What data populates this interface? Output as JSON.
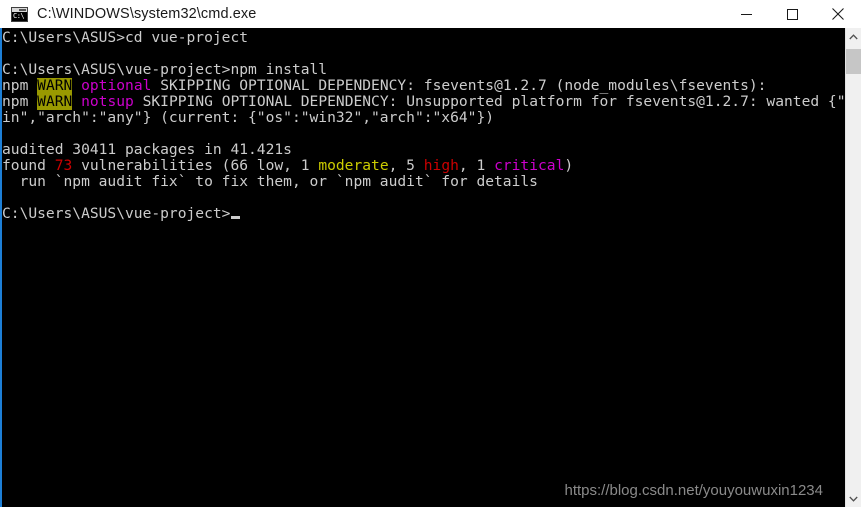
{
  "window": {
    "title": "C:\\WINDOWS\\system32\\cmd.exe",
    "icon_name": "cmd-icon",
    "icon_glyph": "C:\\",
    "controls": {
      "minimize_label": "Minimize",
      "maximize_label": "Maximize",
      "close_label": "Close"
    }
  },
  "console": {
    "background_color": "#000000",
    "foreground_color": "#cccccc",
    "focus_border_color": "#1d7fd6",
    "cursor": "_",
    "lines": [
      {
        "id": "line-cd",
        "segments": [
          {
            "text": "C:\\Users\\ASUS>cd vue-project",
            "color": "#cccccc"
          }
        ]
      },
      {
        "id": "line-blank-1",
        "segments": [
          {
            "text": "",
            "color": "#cccccc"
          }
        ]
      },
      {
        "id": "line-npm-install",
        "segments": [
          {
            "text": "C:\\Users\\ASUS\\vue-project>npm install",
            "color": "#cccccc"
          }
        ]
      },
      {
        "id": "line-warn-optional",
        "segments": [
          {
            "text": "npm ",
            "color": "#cccccc"
          },
          {
            "text": "WARN",
            "color": "#000000",
            "background": "#999900"
          },
          {
            "text": " ",
            "color": "#cccccc"
          },
          {
            "text": "optional",
            "color": "#cc00cc"
          },
          {
            "text": " SKIPPING OPTIONAL DEPENDENCY: fsevents@1.2.7 (node_modules\\fsevents):",
            "color": "#cccccc"
          }
        ]
      },
      {
        "id": "line-warn-notsup",
        "segments": [
          {
            "text": "npm ",
            "color": "#cccccc"
          },
          {
            "text": "WARN",
            "color": "#000000",
            "background": "#999900"
          },
          {
            "text": " ",
            "color": "#cccccc"
          },
          {
            "text": "notsup",
            "color": "#cc00cc"
          },
          {
            "text": " SKIPPING OPTIONAL DEPENDENCY: Unsupported platform for fsevents@1.2.7: wanted {\"os\":\"darw",
            "color": "#cccccc"
          }
        ]
      },
      {
        "id": "line-warn-wrap",
        "segments": [
          {
            "text": "in\",\"arch\":\"any\"} (current: {\"os\":\"win32\",\"arch\":\"x64\"})",
            "color": "#cccccc"
          }
        ]
      },
      {
        "id": "line-blank-2",
        "segments": [
          {
            "text": "",
            "color": "#cccccc"
          }
        ]
      },
      {
        "id": "line-audited",
        "segments": [
          {
            "text": "audited 30411 packages in 41.421s",
            "color": "#cccccc"
          }
        ]
      },
      {
        "id": "line-found-vulns",
        "segments": [
          {
            "text": "found ",
            "color": "#cccccc"
          },
          {
            "text": "73",
            "color": "#cc0000"
          },
          {
            "text": " vulnerabilities (66 low, 1 ",
            "color": "#cccccc"
          },
          {
            "text": "moderate",
            "color": "#cccc00"
          },
          {
            "text": ", 5 ",
            "color": "#cccccc"
          },
          {
            "text": "high",
            "color": "#cc0000"
          },
          {
            "text": ", 1 ",
            "color": "#cccccc"
          },
          {
            "text": "critical",
            "color": "#cc00cc"
          },
          {
            "text": ")",
            "color": "#cccccc"
          }
        ]
      },
      {
        "id": "line-run-audit-fix",
        "segments": [
          {
            "text": "  run `npm audit fix` to fix them, or `npm audit` for details",
            "color": "#cccccc"
          }
        ]
      },
      {
        "id": "line-blank-3",
        "segments": [
          {
            "text": "",
            "color": "#cccccc"
          }
        ]
      },
      {
        "id": "line-prompt",
        "segments": [
          {
            "text": "C:\\Users\\ASUS\\vue-project>",
            "color": "#cccccc"
          }
        ],
        "cursor": true
      }
    ]
  },
  "watermark": {
    "text": "https://blog.csdn.net/youyouwuxin1234"
  },
  "scrollbar": {
    "up_arrow": "⌃",
    "down_arrow": "⌄",
    "thumb_position_percent": 1
  }
}
